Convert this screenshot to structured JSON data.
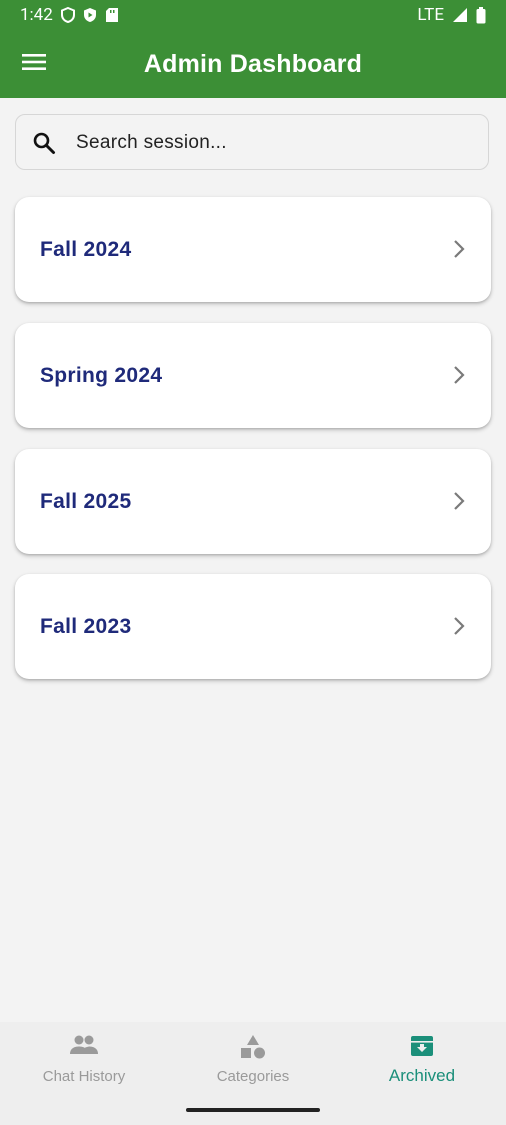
{
  "status_bar": {
    "time": "1:42",
    "network": "LTE"
  },
  "app_bar": {
    "title": "Admin Dashboard"
  },
  "search": {
    "placeholder": "Search session..."
  },
  "sessions": [
    {
      "label": "Fall 2024"
    },
    {
      "label": "Spring 2024"
    },
    {
      "label": "Fall 2025"
    },
    {
      "label": "Fall 2023"
    }
  ],
  "bottom_nav": {
    "items": [
      {
        "label": "Chat History",
        "icon": "people-icon",
        "active": false
      },
      {
        "label": "Categories",
        "icon": "category-shapes-icon",
        "active": false
      },
      {
        "label": "Archived",
        "icon": "archive-icon",
        "active": true
      }
    ]
  },
  "colors": {
    "primary": "#3c8f36",
    "session_text": "#1f2a7a",
    "active_nav": "#1b8f7a",
    "inactive_nav": "#9a9a9a"
  }
}
